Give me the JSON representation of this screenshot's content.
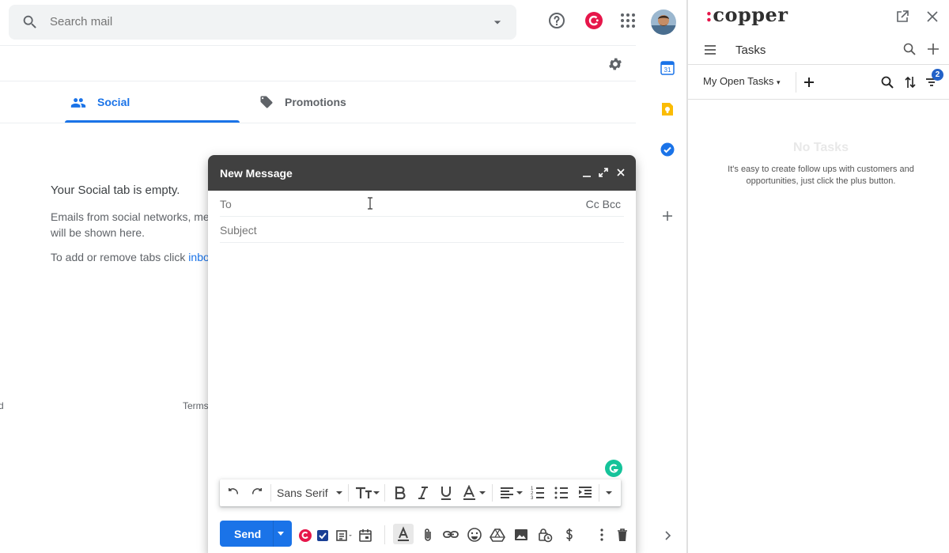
{
  "search": {
    "placeholder": "Search mail"
  },
  "tabs": [
    {
      "label": "Social",
      "active": true
    },
    {
      "label": "Promotions",
      "active": false
    }
  ],
  "empty_state": {
    "title": "Your Social tab is empty.",
    "desc_line1": "Emails from social networks, medi",
    "desc_line2": "will be shown here.",
    "tabs_prefix": "To add or remove tabs click ",
    "tabs_link": "inbox s"
  },
  "footer": {
    "terms": "Terms",
    "left": "d"
  },
  "side_strip": {
    "calendar_day": "31"
  },
  "compose": {
    "title": "New Message",
    "to_label": "To",
    "cc_bcc": "Cc Bcc",
    "subject_label": "Subject",
    "font": "Sans Serif",
    "send_label": "Send"
  },
  "copper": {
    "logo_dot": ":",
    "logo_text": "copper",
    "nav_title": "Tasks",
    "filter_label": "My Open Tasks",
    "filter_badge": "2",
    "no_tasks_title": "No Tasks",
    "no_tasks_desc": "It's easy to create follow ups with customers and opportunities, just click the plus button."
  },
  "colors": {
    "accent": "#1a73e8",
    "compose_header": "#404040",
    "copper_brand": "#e6164a",
    "badge": "#2362c8"
  }
}
